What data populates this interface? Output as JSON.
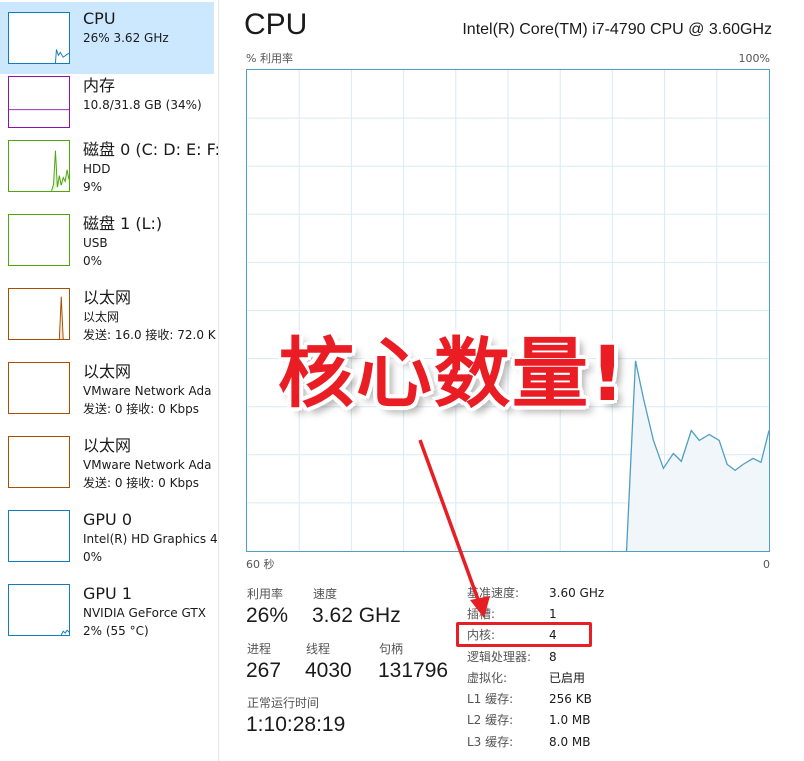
{
  "sidebar": {
    "items": [
      {
        "title": "CPU",
        "line1": "26% 3.62 GHz",
        "line2": "",
        "color": "#117dbb",
        "selected": true
      },
      {
        "title": "内存",
        "line1": "10.8/31.8 GB (34%)",
        "line2": "",
        "color": "#8b12ae",
        "selected": false
      },
      {
        "title": "磁盘 0 (C: D: E: F:",
        "line1": "HDD",
        "line2": "9%",
        "color": "#4da60c",
        "selected": false
      },
      {
        "title": "磁盘 1 (L:)",
        "line1": "USB",
        "line2": "0%",
        "color": "#4da60c",
        "selected": false
      },
      {
        "title": "以太网",
        "line1": "以太网",
        "line2": "发送: 16.0 接收: 72.0 K",
        "color": "#a74f01",
        "selected": false
      },
      {
        "title": "以太网",
        "line1": "VMware Network Ada",
        "line2": "发送: 0 接收: 0 Kbps",
        "color": "#a74f01",
        "selected": false
      },
      {
        "title": "以太网",
        "line1": "VMware Network Ada",
        "line2": "发送: 0 接收: 0 Kbps",
        "color": "#a74f01",
        "selected": false
      },
      {
        "title": "GPU 0",
        "line1": "Intel(R) HD Graphics 4",
        "line2": "0%",
        "color": "#117dbb",
        "selected": false
      },
      {
        "title": "GPU 1",
        "line1": "NVIDIA GeForce GTX",
        "line2": "2% (55 °C)",
        "color": "#117dbb",
        "selected": false
      }
    ]
  },
  "main": {
    "title": "CPU",
    "model": "Intel(R) Core(TM) i7-4790 CPU @ 3.60GHz",
    "graph": {
      "y_label": "% 利用率",
      "y_max_label": "100%",
      "x_left_label": "60 秒",
      "x_right_label": "0",
      "line_color": "#4f9ec4",
      "grid_color": "#d9eaf4",
      "fill_color": "#f1f6fa"
    },
    "stats": {
      "utilization_label": "利用率",
      "utilization_value": "26%",
      "speed_label": "速度",
      "speed_value": "3.62 GHz",
      "processes_label": "进程",
      "processes_value": "267",
      "threads_label": "线程",
      "threads_value": "4030",
      "handles_label": "句柄",
      "handles_value": "131796",
      "uptime_label": "正常运行时间",
      "uptime_value": "1:10:28:19"
    },
    "details": [
      {
        "label": "基准速度:",
        "value": "3.60 GHz"
      },
      {
        "label": "插槽:",
        "value": "1"
      },
      {
        "label": "内核:",
        "value": "4"
      },
      {
        "label": "逻辑处理器:",
        "value": "8"
      },
      {
        "label": "虚拟化:",
        "value": "已启用"
      },
      {
        "label": "L1 缓存:",
        "value": "256 KB"
      },
      {
        "label": "L2 缓存:",
        "value": "1.0 MB"
      },
      {
        "label": "L3 缓存:",
        "value": "8.0 MB"
      }
    ]
  },
  "annotation": {
    "text": "核心数量!",
    "color": "#ea1c24"
  }
}
